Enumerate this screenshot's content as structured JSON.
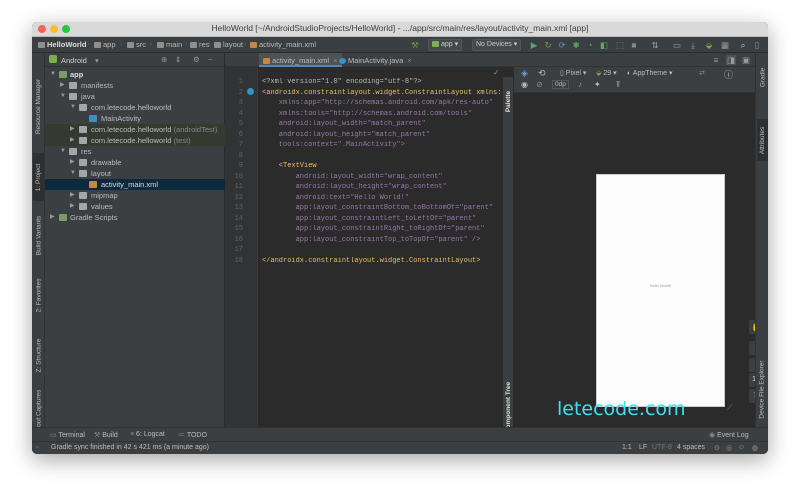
{
  "colors": {
    "accent": "#4a88c7",
    "watermark": "#3de1f0",
    "editor_bg": "#2b2b2b",
    "panel_bg": "#3c3f41"
  },
  "window": {
    "title": "HelloWorld [~/AndroidStudioProjects/HelloWorld] - .../app/src/main/res/layout/activity_main.xml [app]"
  },
  "breadcrumbs": [
    "HelloWorld",
    "app",
    "src",
    "main",
    "res",
    "layout",
    "activity_main.xml"
  ],
  "toolbar": {
    "config": "app",
    "device": "No Devices"
  },
  "project_panel": {
    "view": "Android",
    "tree": [
      {
        "label": "app",
        "suffix": ""
      },
      {
        "label": "manifests",
        "suffix": ""
      },
      {
        "label": "java",
        "suffix": ""
      },
      {
        "label": "com.letecode.helloworld",
        "suffix": ""
      },
      {
        "label": "MainActivity",
        "suffix": ""
      },
      {
        "label": "com.letecode.helloworld",
        "suffix": "(androidTest)"
      },
      {
        "label": "com.letecode.helloworld",
        "suffix": "(test)"
      },
      {
        "label": "res",
        "suffix": ""
      },
      {
        "label": "drawable",
        "suffix": ""
      },
      {
        "label": "layout",
        "suffix": ""
      },
      {
        "label": "activity_main.xml",
        "suffix": ""
      },
      {
        "label": "mipmap",
        "suffix": ""
      },
      {
        "label": "values",
        "suffix": ""
      },
      {
        "label": "Gradle Scripts",
        "suffix": ""
      }
    ]
  },
  "left_strip": [
    "Resource Manager",
    "1: Project",
    "Build Variants",
    "2: Favorites",
    "Z: Structure",
    "Layout Captures"
  ],
  "right_strip": [
    "Gradle",
    "Attributes",
    "Device File Explorer"
  ],
  "editor_tabs": [
    "activity_main.xml",
    "MainActivity.java"
  ],
  "editor": {
    "line_numbers": [
      "1",
      "2",
      "3",
      "4",
      "5",
      "6",
      "7",
      "8",
      "9",
      "10",
      "11",
      "12",
      "13",
      "14",
      "15",
      "16",
      "17",
      "18"
    ],
    "code": [
      "<?xml version=\"1.0\" encoding=\"utf-8\"?>",
      "<androidx.constraintlayout.widget.ConstraintLayout xmlns:and",
      "    xmlns:app=\"http://schemas.android.com/apk/res-auto\"",
      "    xmlns:tools=\"http://schemas.android.com/tools\"",
      "    android:layout_width=\"match_parent\"",
      "    android:layout_height=\"match_parent\"",
      "    tools:context=\".MainActivity\">",
      "",
      "    <TextView",
      "        android:layout_width=\"wrap_content\"",
      "        android:layout_height=\"wrap_content\"",
      "        android:text=\"Hello World!\"",
      "        app:layout_constraintBottom_toBottomOf=\"parent\"",
      "        app:layout_constraintLeft_toLeftOf=\"parent\"",
      "        app:layout_constraintRight_toRightOf=\"parent\"",
      "        app:layout_constraintTop_toTopOf=\"parent\" />",
      "",
      "</androidx.constraintlayout.widget.ConstraintLayout>"
    ]
  },
  "palette_tabs": [
    "Palette",
    "Component Tree"
  ],
  "design": {
    "device": "Pixel",
    "api": "29",
    "theme": "AppTheme",
    "margin": "0dp",
    "preview_text": "Hello World!"
  },
  "bottom_tools": [
    "Terminal",
    "Build",
    "6: Logcat",
    "TODO",
    "Event Log"
  ],
  "status": {
    "message": "Gradle sync finished in 42 s 421 ms (a minute ago)",
    "position": "1:1",
    "line_sep": "LF",
    "encoding": "UTF-8",
    "indent": "4 spaces"
  },
  "watermark": "letecode.com"
}
